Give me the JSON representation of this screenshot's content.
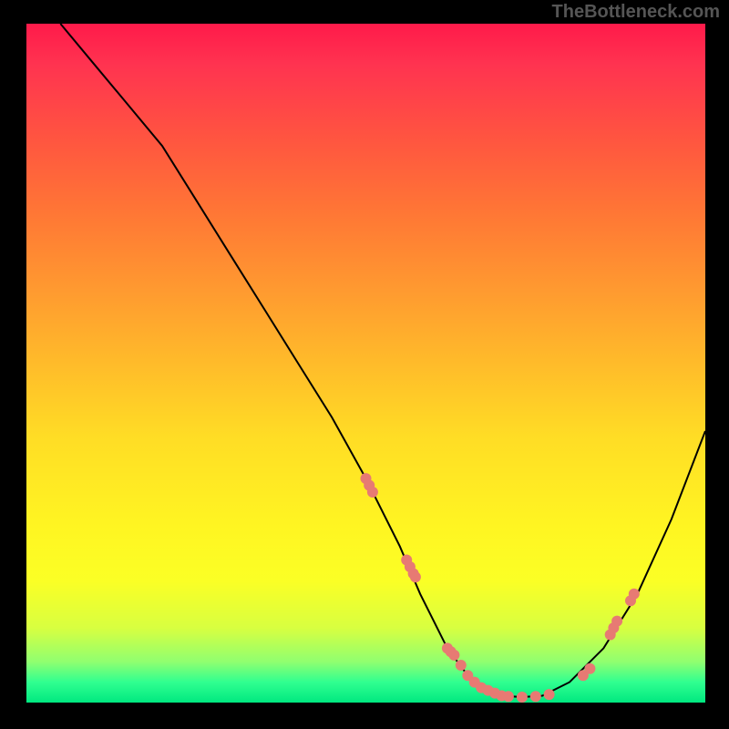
{
  "watermark": "TheBottleneck.com",
  "chart_data": {
    "type": "line",
    "title": "",
    "xlabel": "",
    "ylabel": "",
    "xlim": [
      0,
      100
    ],
    "ylim": [
      0,
      100
    ],
    "curve": {
      "x": [
        5,
        10,
        15,
        20,
        25,
        30,
        35,
        40,
        45,
        50,
        55,
        58,
        60,
        62,
        65,
        68,
        70,
        73,
        76,
        80,
        85,
        90,
        95,
        100
      ],
      "y": [
        100,
        94,
        88,
        82,
        74,
        66,
        58,
        50,
        42,
        33,
        23,
        16,
        12,
        8,
        4,
        2,
        1,
        0.8,
        1,
        3,
        8,
        16,
        27,
        40
      ]
    },
    "markers": {
      "x": [
        50,
        50.5,
        51,
        56,
        56.5,
        57,
        57.3,
        62,
        62.5,
        63,
        64,
        65,
        66,
        67,
        68,
        69,
        70,
        71,
        73,
        75,
        77,
        82,
        83,
        86,
        86.5,
        87,
        89,
        89.5
      ],
      "y": [
        33,
        32,
        31,
        21,
        20,
        19,
        18.5,
        8,
        7.5,
        7,
        5.5,
        4,
        3,
        2.2,
        1.8,
        1.4,
        1,
        0.9,
        0.8,
        0.9,
        1.2,
        4,
        5,
        10,
        11,
        12,
        15,
        16
      ],
      "color": "#e77a73"
    }
  }
}
